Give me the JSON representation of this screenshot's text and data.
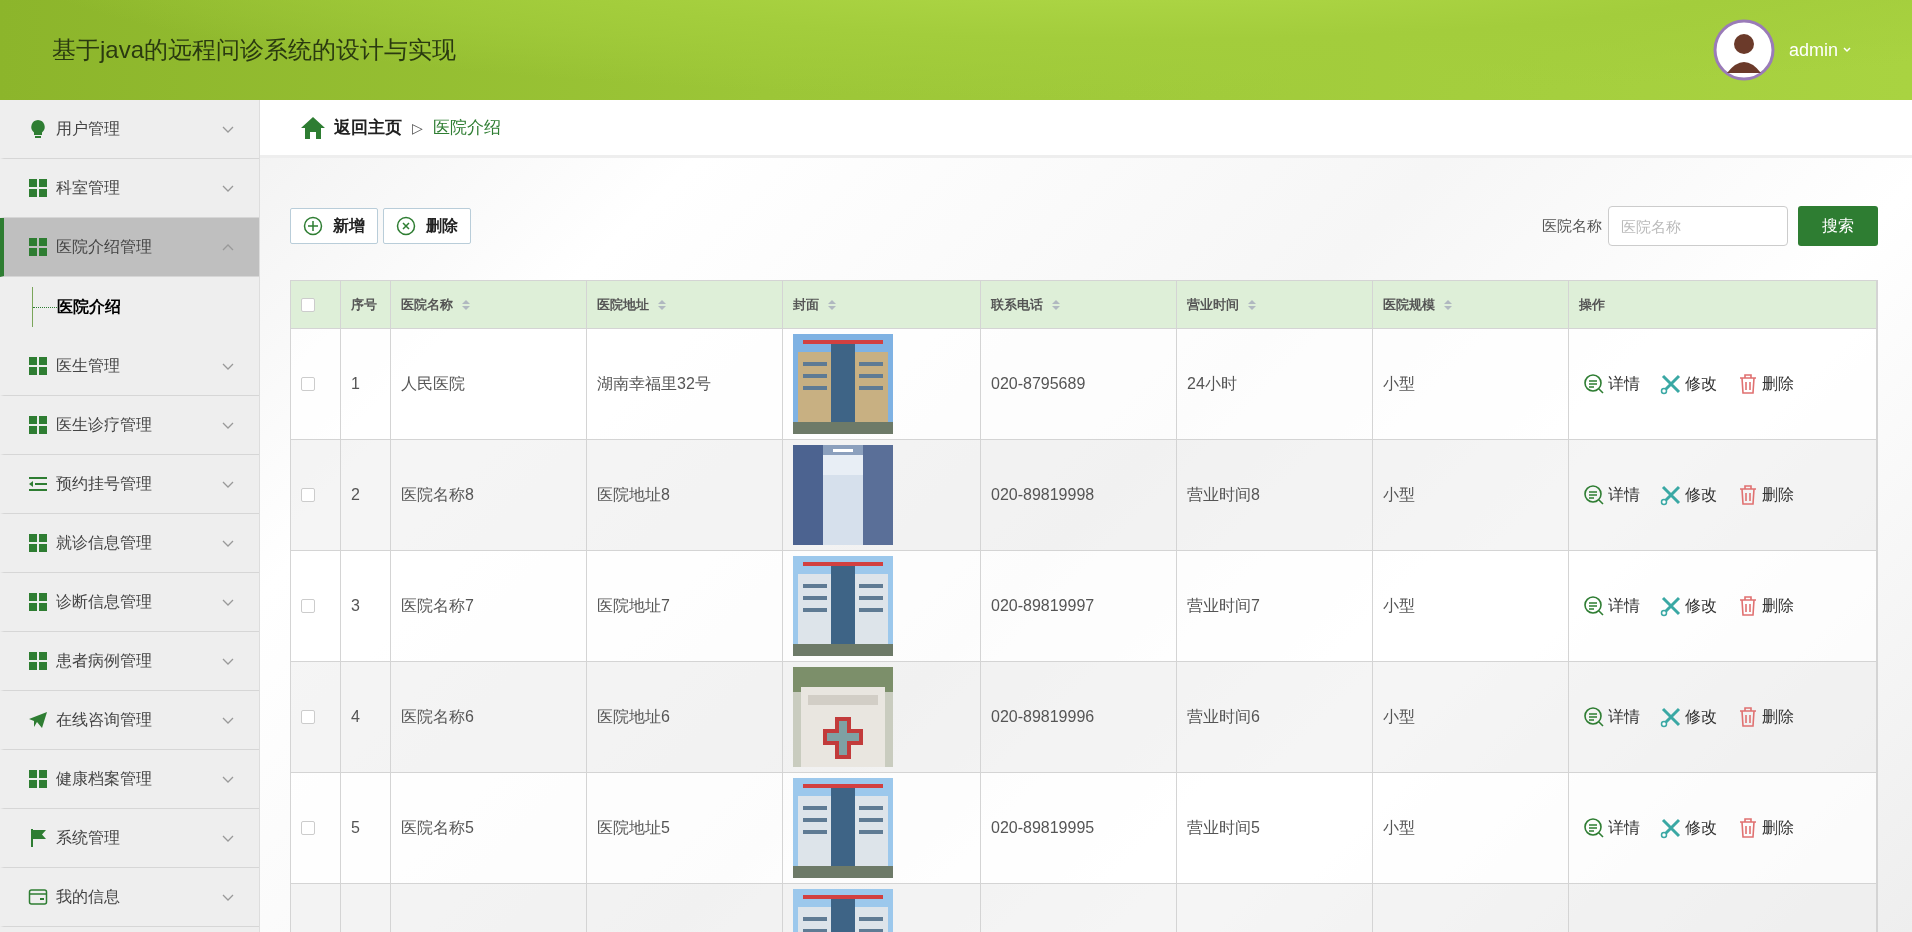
{
  "header": {
    "title": "基于java的远程问诊系统的设计与实现",
    "user": "admin"
  },
  "sidebar": {
    "items": [
      {
        "kind": "bulb",
        "label": "用户管理",
        "expanded": false,
        "selected": false
      },
      {
        "kind": "grid",
        "label": "科室管理",
        "expanded": false,
        "selected": false
      },
      {
        "kind": "grid",
        "label": "医院介绍管理",
        "expanded": true,
        "selected": true,
        "children": [
          {
            "label": "医院介绍",
            "selected": true
          }
        ]
      },
      {
        "kind": "grid",
        "label": "医生管理",
        "expanded": false,
        "selected": false
      },
      {
        "kind": "grid",
        "label": "医生诊疗管理",
        "expanded": false,
        "selected": false
      },
      {
        "kind": "list",
        "label": "预约挂号管理",
        "expanded": false,
        "selected": false
      },
      {
        "kind": "grid",
        "label": "就诊信息管理",
        "expanded": false,
        "selected": false
      },
      {
        "kind": "grid",
        "label": "诊断信息管理",
        "expanded": false,
        "selected": false
      },
      {
        "kind": "grid",
        "label": "患者病例管理",
        "expanded": false,
        "selected": false
      },
      {
        "kind": "plane",
        "label": "在线咨询管理",
        "expanded": false,
        "selected": false
      },
      {
        "kind": "grid",
        "label": "健康档案管理",
        "expanded": false,
        "selected": false
      },
      {
        "kind": "flag",
        "label": "系统管理",
        "expanded": false,
        "selected": false
      },
      {
        "kind": "card",
        "label": "我的信息",
        "expanded": false,
        "selected": false
      }
    ]
  },
  "breadcrumb": {
    "home": "返回主页",
    "separator": "▷",
    "current": "医院介绍"
  },
  "toolbar": {
    "buttons": [
      {
        "kind": "add",
        "label": "新增"
      },
      {
        "kind": "remove",
        "label": "删除"
      }
    ],
    "search": {
      "label": "医院名称",
      "placeholder": "医院名称",
      "button": "搜索"
    }
  },
  "table": {
    "all_checked": false,
    "columns": [
      {
        "label": "序号",
        "sortable": false
      },
      {
        "label": "医院名称",
        "sortable": true
      },
      {
        "label": "医院地址",
        "sortable": true
      },
      {
        "label": "封面",
        "sortable": true
      },
      {
        "label": "联系电话",
        "sortable": true
      },
      {
        "label": "营业时间",
        "sortable": true
      },
      {
        "label": "医院规模",
        "sortable": true
      },
      {
        "label": "操作",
        "sortable": false
      }
    ],
    "rows": [
      {
        "checked": false,
        "index": "1",
        "name": "人民医院",
        "address": "湖南幸福里32号",
        "cover": {
          "kind": "picture"
        },
        "phone": "020-8795689",
        "hours": "24小时",
        "scale": "小型",
        "actions": [
          {
            "kind": "detail",
            "label": "详情"
          },
          {
            "kind": "edit",
            "label": "修改"
          },
          {
            "kind": "delete",
            "label": "删除"
          }
        ]
      },
      {
        "checked": false,
        "index": "2",
        "name": "医院名称8",
        "address": "医院地址8",
        "cover": {
          "kind": "picture"
        },
        "phone": "020-89819998",
        "hours": "营业时间8",
        "scale": "小型",
        "actions": [
          {
            "kind": "detail",
            "label": "详情"
          },
          {
            "kind": "edit",
            "label": "修改"
          },
          {
            "kind": "delete",
            "label": "删除"
          }
        ]
      },
      {
        "checked": false,
        "index": "3",
        "name": "医院名称7",
        "address": "医院地址7",
        "cover": {
          "kind": "picture"
        },
        "phone": "020-89819997",
        "hours": "营业时间7",
        "scale": "小型",
        "actions": [
          {
            "kind": "detail",
            "label": "详情"
          },
          {
            "kind": "edit",
            "label": "修改"
          },
          {
            "kind": "delete",
            "label": "删除"
          }
        ]
      },
      {
        "checked": false,
        "index": "4",
        "name": "医院名称6",
        "address": "医院地址6",
        "cover": {
          "kind": "picture"
        },
        "phone": "020-89819996",
        "hours": "营业时间6",
        "scale": "小型",
        "actions": [
          {
            "kind": "detail",
            "label": "详情"
          },
          {
            "kind": "edit",
            "label": "修改"
          },
          {
            "kind": "delete",
            "label": "删除"
          }
        ]
      },
      {
        "checked": false,
        "index": "5",
        "name": "医院名称5",
        "address": "医院地址5",
        "cover": {
          "kind": "picture"
        },
        "phone": "020-89819995",
        "hours": "营业时间5",
        "scale": "小型",
        "actions": [
          {
            "kind": "detail",
            "label": "详情"
          },
          {
            "kind": "edit",
            "label": "修改"
          },
          {
            "kind": "delete",
            "label": "删除"
          }
        ]
      },
      {
        "cover": {
          "kind": "picture"
        }
      }
    ]
  }
}
